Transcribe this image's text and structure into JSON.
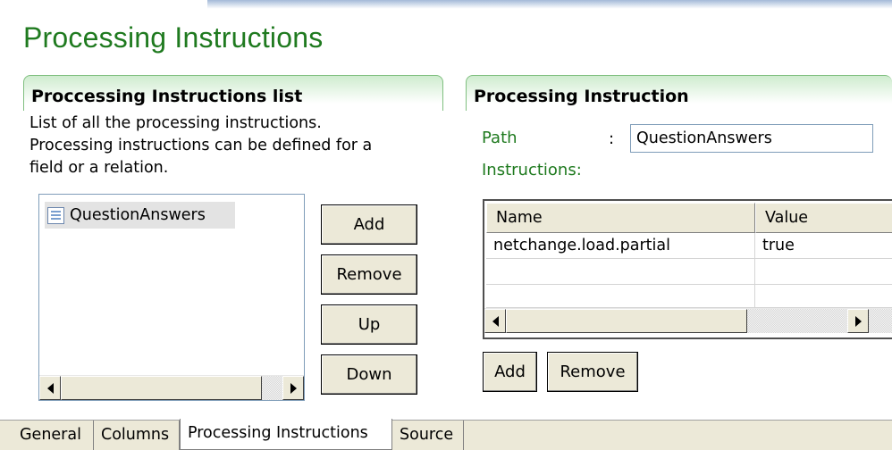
{
  "page": {
    "title": "Processing Instructions"
  },
  "list_section": {
    "header": "Proccessing Instructions list",
    "description": [
      "List of all the processing instructions.",
      "Processing instructions can be defined for a",
      "field or a relation."
    ],
    "items": [
      {
        "label": "QuestionAnswers",
        "icon": "table-icon"
      }
    ],
    "buttons": {
      "add": "Add",
      "remove": "Remove",
      "up": "Up",
      "down": "Down"
    }
  },
  "detail_section": {
    "header": "Processing Instruction",
    "path_label": "Path",
    "colon": ":",
    "path_value": "QuestionAnswers",
    "instructions_label": "Instructions:",
    "grid": {
      "columns": [
        "Name",
        "Value"
      ],
      "rows": [
        {
          "name": "netchange.load.partial",
          "value": "true"
        }
      ]
    },
    "buttons": {
      "add": "Add",
      "remove": "Remove"
    }
  },
  "tabs": [
    {
      "label": "General",
      "active": false
    },
    {
      "label": "Columns",
      "active": false
    },
    {
      "label": "Processing Instructions",
      "active": true
    },
    {
      "label": "Source",
      "active": false
    }
  ],
  "colors": {
    "title_green": "#1f7a1f",
    "header_border": "#7fbf7f",
    "header_gradient": "#cfeccf"
  }
}
